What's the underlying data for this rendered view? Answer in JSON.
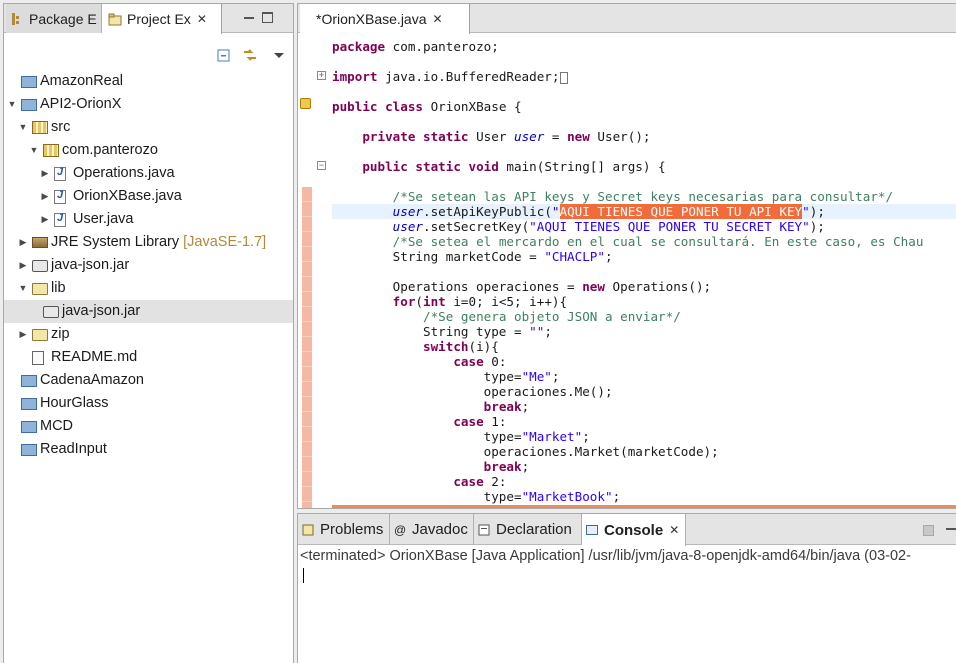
{
  "left_view": {
    "tabs": [
      {
        "label": "Package E",
        "active": false
      },
      {
        "label": "Project Ex",
        "active": true
      }
    ],
    "tree": [
      {
        "label": "AmazonReal",
        "icon": "project-icon",
        "indent": 0,
        "expanded": null
      },
      {
        "label": "API2-OrionX",
        "icon": "project-icon",
        "indent": 0,
        "expanded": true
      },
      {
        "label": "src",
        "icon": "source-folder-icon",
        "indent": 1,
        "expanded": true
      },
      {
        "label": "com.panterozo",
        "icon": "package-icon",
        "indent": 2,
        "expanded": true
      },
      {
        "label": "Operations.java",
        "icon": "java-file-icon",
        "indent": 3,
        "expanded": false
      },
      {
        "label": "OrionXBase.java",
        "icon": "java-file-icon",
        "indent": 3,
        "expanded": false
      },
      {
        "label": "User.java",
        "icon": "java-file-icon",
        "indent": 3,
        "expanded": false
      },
      {
        "label": "JRE System Library",
        "decoration": "[JavaSE-1.7]",
        "icon": "library-icon",
        "indent": 1,
        "expanded": false
      },
      {
        "label": "java-json.jar",
        "icon": "jar-icon",
        "indent": 1,
        "expanded": false
      },
      {
        "label": "lib",
        "icon": "folder-icon",
        "indent": 1,
        "expanded": true
      },
      {
        "label": "java-json.jar",
        "icon": "jar-file-icon",
        "indent": 2,
        "expanded": null,
        "selected": true
      },
      {
        "label": "zip",
        "icon": "folder-icon",
        "indent": 1,
        "expanded": false
      },
      {
        "label": "README.md",
        "icon": "markdown-file-icon",
        "indent": 1,
        "expanded": null
      },
      {
        "label": "CadenaAmazon",
        "icon": "project-icon",
        "indent": 0,
        "expanded": null
      },
      {
        "label": "HourGlass",
        "icon": "project-icon",
        "indent": 0,
        "expanded": null
      },
      {
        "label": "MCD",
        "icon": "project-icon",
        "indent": 0,
        "expanded": null
      },
      {
        "label": "ReadInput",
        "icon": "project-icon",
        "indent": 0,
        "expanded": null
      }
    ]
  },
  "editor": {
    "tab_label": "*OrionXBase.java",
    "lines": [
      [
        {
          "t": "package",
          "c": "kw"
        },
        {
          "t": " com.panterozo;"
        }
      ],
      [],
      [
        {
          "t": "import",
          "c": "kw"
        },
        {
          "t": " java.io.BufferedReader;"
        },
        {
          "t": "",
          "c": "foldbox"
        }
      ],
      [],
      [
        {
          "t": "public class",
          "c": "kw"
        },
        {
          "t": " OrionXBase {"
        }
      ],
      [],
      [
        {
          "t": "    "
        },
        {
          "t": "private static",
          "c": "kw"
        },
        {
          "t": " User "
        },
        {
          "t": "user",
          "c": "fld"
        },
        {
          "t": " = "
        },
        {
          "t": "new",
          "c": "kw"
        },
        {
          "t": " User();"
        }
      ],
      [],
      [
        {
          "t": "    "
        },
        {
          "t": "public static void",
          "c": "kw"
        },
        {
          "t": " main(String[] args) {"
        }
      ],
      [],
      [
        {
          "t": "        "
        },
        {
          "t": "/*Se setean las API keys y Secret keys necesarias para consultar*/",
          "c": "cm"
        }
      ],
      [
        {
          "t": "        "
        },
        {
          "t": "user",
          "c": "fld"
        },
        {
          "t": ".setApiKeyPublic("
        },
        {
          "t": "\"",
          "c": "str"
        },
        {
          "t": "AQUI TIENES QUE PONER TU API KEY",
          "c": "hl"
        },
        {
          "t": "\"",
          "c": "str"
        },
        {
          "t": ");"
        }
      ],
      [
        {
          "t": "        "
        },
        {
          "t": "user",
          "c": "fld"
        },
        {
          "t": ".setSecretKey("
        },
        {
          "t": "\"AQUI TIENES QUE PONER TU SECRET KEY\"",
          "c": "str"
        },
        {
          "t": ");"
        }
      ],
      [
        {
          "t": "        "
        },
        {
          "t": "/*Se setea el mercardo en el cual se consultará. En este caso, es Chau",
          "c": "cm"
        }
      ],
      [
        {
          "t": "        String marketCode = "
        },
        {
          "t": "\"CHACLP\"",
          "c": "str"
        },
        {
          "t": ";"
        }
      ],
      [],
      [
        {
          "t": "        Operations operaciones = "
        },
        {
          "t": "new",
          "c": "kw"
        },
        {
          "t": " Operations();"
        }
      ],
      [
        {
          "t": "        "
        },
        {
          "t": "for",
          "c": "kw"
        },
        {
          "t": "("
        },
        {
          "t": "int",
          "c": "kw"
        },
        {
          "t": " i=0; i<5; i++){"
        }
      ],
      [
        {
          "t": "            "
        },
        {
          "t": "/*Se genera objeto JSON a enviar*/",
          "c": "cm"
        }
      ],
      [
        {
          "t": "            String type = "
        },
        {
          "t": "\"\"",
          "c": "str"
        },
        {
          "t": ";"
        }
      ],
      [
        {
          "t": "            "
        },
        {
          "t": "switch",
          "c": "kw"
        },
        {
          "t": "(i){"
        }
      ],
      [
        {
          "t": "                "
        },
        {
          "t": "case",
          "c": "kw"
        },
        {
          "t": " 0:"
        }
      ],
      [
        {
          "t": "                    type="
        },
        {
          "t": "\"Me\"",
          "c": "str"
        },
        {
          "t": ";"
        }
      ],
      [
        {
          "t": "                    operaciones.Me();"
        }
      ],
      [
        {
          "t": "                    "
        },
        {
          "t": "break",
          "c": "kw"
        },
        {
          "t": ";"
        }
      ],
      [
        {
          "t": "                "
        },
        {
          "t": "case",
          "c": "kw"
        },
        {
          "t": " 1:"
        }
      ],
      [
        {
          "t": "                    type="
        },
        {
          "t": "\"Market\"",
          "c": "str"
        },
        {
          "t": ";"
        }
      ],
      [
        {
          "t": "                    operaciones.Market(marketCode);"
        }
      ],
      [
        {
          "t": "                    "
        },
        {
          "t": "break",
          "c": "kw"
        },
        {
          "t": ";"
        }
      ],
      [
        {
          "t": "                "
        },
        {
          "t": "case",
          "c": "kw"
        },
        {
          "t": " 2:"
        }
      ],
      [
        {
          "t": "                    type="
        },
        {
          "t": "\"MarketBook\"",
          "c": "str"
        },
        {
          "t": ";"
        }
      ]
    ],
    "current_line": 11
  },
  "console_view": {
    "tabs": [
      {
        "label": "Problems",
        "icon": "problems-icon"
      },
      {
        "label": "Javadoc",
        "icon": "javadoc-icon"
      },
      {
        "label": "Declaration",
        "icon": "declaration-icon"
      },
      {
        "label": "Console",
        "icon": "console-icon",
        "active": true
      }
    ],
    "status": "<terminated> OrionXBase [Java Application] /usr/lib/jvm/java-8-openjdk-amd64/bin/java (03-02-"
  },
  "colors": {
    "keyword": "#7f0055",
    "comment": "#3f7f5f",
    "string": "#2a00ff",
    "field": "#0000c0",
    "highlight": "#f26b3a",
    "selection": "#e2e2e2"
  }
}
